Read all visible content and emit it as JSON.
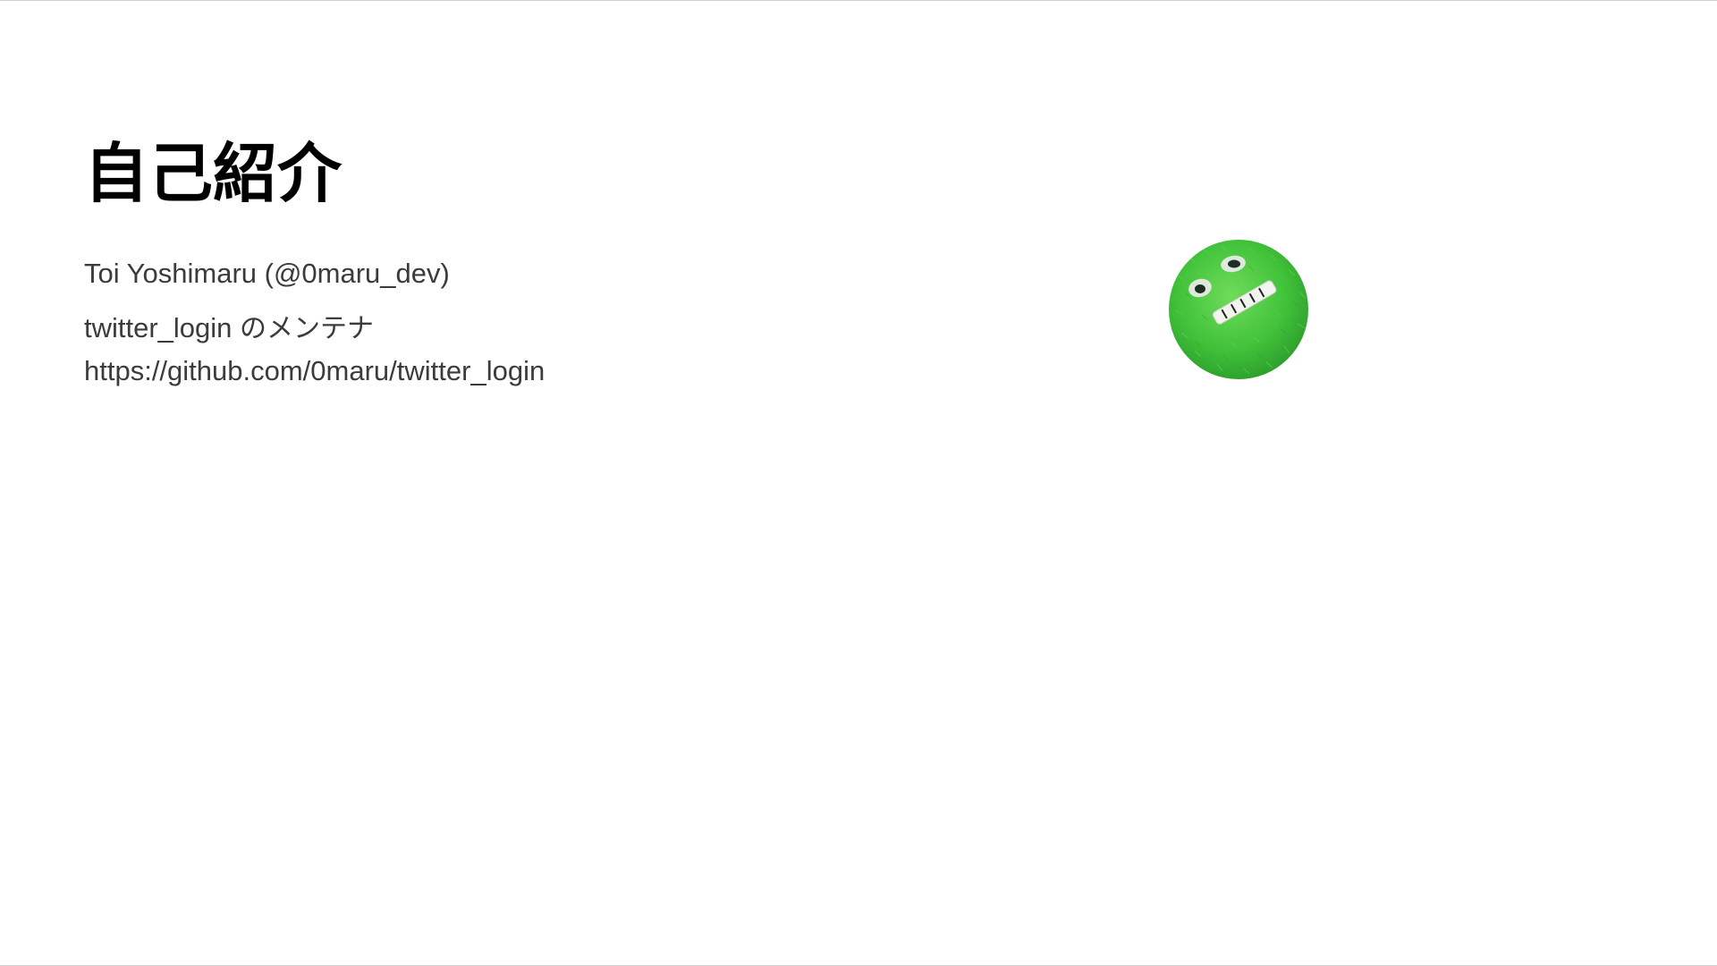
{
  "slide": {
    "title": "自己紹介",
    "name_line": "Toi Yoshimaru (@0maru_dev)",
    "maintainer_project": "twitter_login",
    "maintainer_suffix": "のメンテナ",
    "repo_url": "https://github.com/0maru/twitter_login"
  },
  "avatar": {
    "icon": "green-fuzzy-monster-avatar-icon",
    "fill_color": "#41c23a"
  },
  "colors": {
    "title": "#000000",
    "body": "#3b3b3b",
    "background": "#ffffff"
  }
}
